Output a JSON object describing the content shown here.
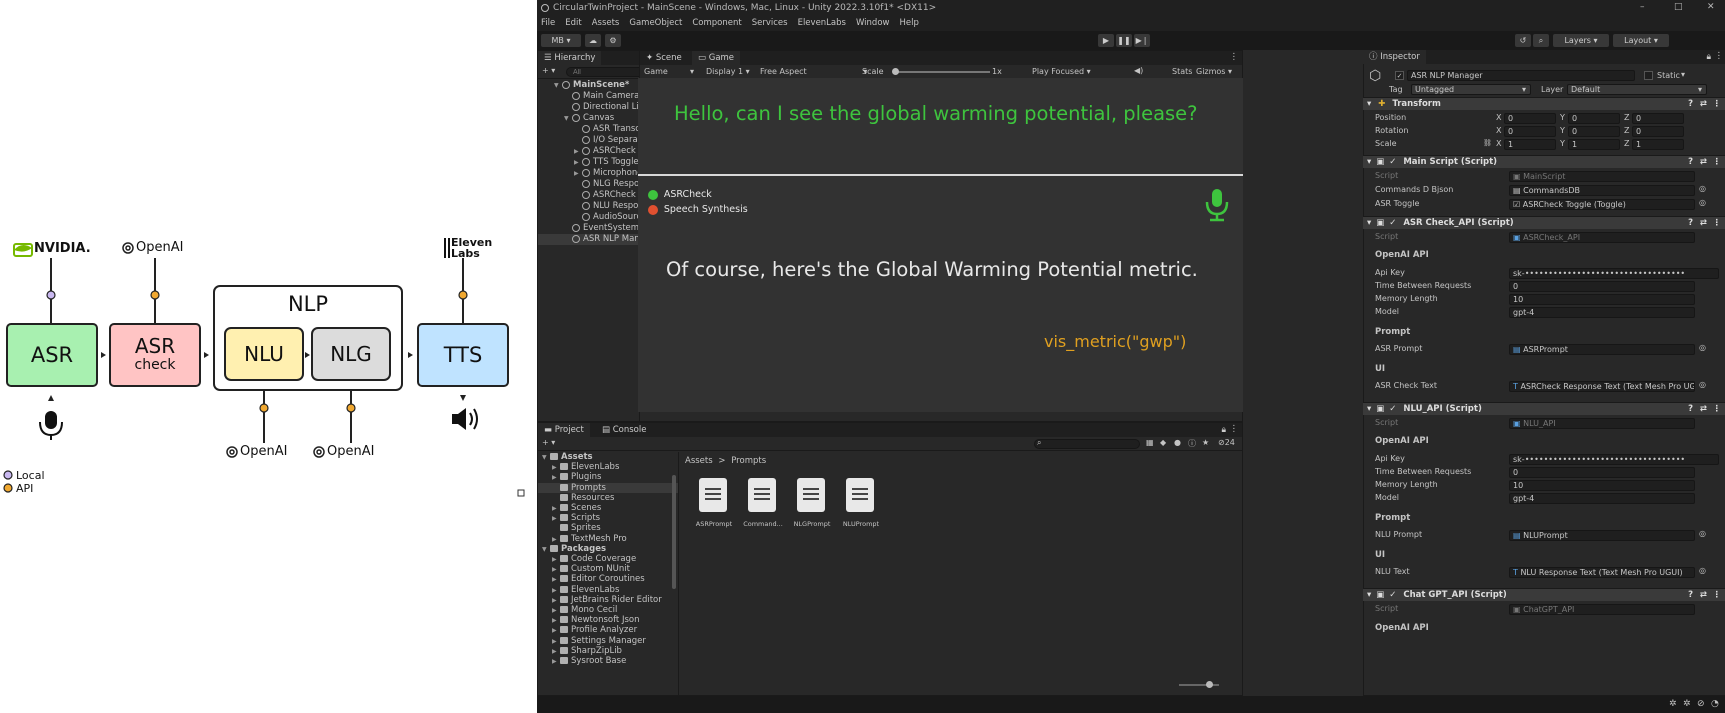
{
  "diagram": {
    "vendors": {
      "nvidia": "NVIDIA.",
      "openai": "OpenAI",
      "elevenlabs_line1": "Eleven",
      "elevenlabs_line2": "Labs"
    },
    "nodes": {
      "asr": "ASR",
      "asr_check_1": "ASR",
      "asr_check_2": "check",
      "nlp": "NLP",
      "nlu": "NLU",
      "nlg": "NLG",
      "tts": "TTS"
    },
    "legend": {
      "local": "Local",
      "api": "API"
    },
    "colors": {
      "asr": "#a8f0b0",
      "asr_check": "#ffc4c4",
      "nlu": "#fff0b0",
      "nlg": "#dcdcdc",
      "tts": "#bfe3ff",
      "local_dot": "#c9b8f0",
      "api_dot": "#f0a830"
    }
  },
  "unity": {
    "title": "CircularTwinProject - MainScene - Windows, Mac, Linux - Unity 2022.3.10f1* <DX11>",
    "menu": [
      "File",
      "Edit",
      "Assets",
      "GameObject",
      "Component",
      "Services",
      "ElevenLabs",
      "Window",
      "Help"
    ],
    "toolbar": {
      "account": "MB",
      "layers": "Layers",
      "layout": "Layout"
    },
    "hierarchy": {
      "tab": "Hierarchy",
      "search_placeholder": "All",
      "items": [
        {
          "label": "MainScene*",
          "depth": 0
        },
        {
          "label": "Main Camera",
          "depth": 1
        },
        {
          "label": "Directional Light",
          "depth": 1
        },
        {
          "label": "Canvas",
          "depth": 1
        },
        {
          "label": "ASR Transcript",
          "depth": 2
        },
        {
          "label": "I/O Separator",
          "depth": 2
        },
        {
          "label": "ASRCheck Toggle",
          "depth": 2
        },
        {
          "label": "TTS Toggle",
          "depth": 2
        },
        {
          "label": "Microphone Toggle",
          "depth": 2
        },
        {
          "label": "NLG Response Text",
          "depth": 2
        },
        {
          "label": "ASRCheck Response Te",
          "depth": 2
        },
        {
          "label": "NLU Response Text",
          "depth": 2
        },
        {
          "label": "AudioSource",
          "depth": 2
        },
        {
          "label": "EventSystem",
          "depth": 1
        },
        {
          "label": "ASR NLP Manager",
          "depth": 1
        }
      ]
    },
    "scene_tabs": {
      "scene": "Scene",
      "game": "Game"
    },
    "game_bar": {
      "mode": "Game",
      "display": "Display 1",
      "aspect": "Free Aspect",
      "scale_label": "Scale",
      "scale_value": "1x",
      "play_focused": "Play Focused",
      "stats": "Stats",
      "gizmos": "Gizmos"
    },
    "game": {
      "user_text": "Hello, can I see the global warming potential, please?",
      "toggle_asrcheck": "ASRCheck",
      "toggle_tts": "Speech Synthesis",
      "response_text": "Of course, here's the Global Warming Potential metric.",
      "command_text": "vis_metric(\"gwp\")",
      "colors": {
        "user_text": "#3ec43e",
        "command_text": "#e0a020",
        "toggle_on": "#3ec43e",
        "toggle_off": "#e05030"
      }
    },
    "project": {
      "tabs": {
        "project": "Project",
        "console": "Console"
      },
      "badge": "24",
      "breadcrumb": {
        "root": "Assets",
        "current": "Prompts"
      },
      "tree": [
        {
          "label": "Assets",
          "depth": 0
        },
        {
          "label": "ElevenLabs",
          "depth": 1
        },
        {
          "label": "Plugins",
          "depth": 1
        },
        {
          "label": "Prompts",
          "depth": 1
        },
        {
          "label": "Resources",
          "depth": 1
        },
        {
          "label": "Scenes",
          "depth": 1
        },
        {
          "label": "Scripts",
          "depth": 1
        },
        {
          "label": "Sprites",
          "depth": 1
        },
        {
          "label": "TextMesh Pro",
          "depth": 1
        },
        {
          "label": "Packages",
          "depth": 0
        },
        {
          "label": "Code Coverage",
          "depth": 1
        },
        {
          "label": "Custom NUnit",
          "depth": 1
        },
        {
          "label": "Editor Coroutines",
          "depth": 1
        },
        {
          "label": "ElevenLabs",
          "depth": 1
        },
        {
          "label": "JetBrains Rider Editor",
          "depth": 1
        },
        {
          "label": "Mono Cecil",
          "depth": 1
        },
        {
          "label": "Newtonsoft Json",
          "depth": 1
        },
        {
          "label": "Profile Analyzer",
          "depth": 1
        },
        {
          "label": "Settings Manager",
          "depth": 1
        },
        {
          "label": "SharpZipLib",
          "depth": 1
        },
        {
          "label": "Sysroot Base",
          "depth": 1
        }
      ],
      "files": [
        "ASRPrompt",
        "Command...",
        "NLGPrompt",
        "NLUPrompt"
      ]
    },
    "inspector": {
      "tab": "Inspector",
      "object_name": "ASR NLP Manager",
      "static": "Static",
      "tag_label": "Tag",
      "tag_value": "Untagged",
      "layer_label": "Layer",
      "layer_value": "Default",
      "transform": {
        "title": "Transform",
        "position": "Position",
        "rotation": "Rotation",
        "scale": "Scale",
        "pos": [
          "0",
          "0",
          "0"
        ],
        "rot": [
          "0",
          "0",
          "0"
        ],
        "scl": [
          "1",
          "1",
          "1"
        ]
      },
      "main_script": {
        "title": "Main Script (Script)",
        "script_label": "Script",
        "script_value": "MainScript",
        "commands_label": "Commands D Bjson",
        "commands_value": "CommandsDB",
        "toggle_label": "ASR Toggle",
        "toggle_value": "ASRCheck Toggle (Toggle)"
      },
      "asr_check_api": {
        "title": "ASR Check_API (Script)",
        "script_label": "Script",
        "script_value": "ASRCheck_API",
        "openai": "OpenAI API",
        "api_key": "Api Key",
        "api_key_value": "sk-••••••••••••••••••••••••••••••••••",
        "time": "Time Between Requests",
        "time_value": "0",
        "memory": "Memory Length",
        "memory_value": "10",
        "model": "Model",
        "model_value": "gpt-4",
        "prompt_section": "Prompt",
        "prompt_label": "ASR Prompt",
        "prompt_value": "ASRPrompt",
        "ui_section": "UI",
        "text_label": "ASR Check Text",
        "text_value": "ASRCheck Response Text (Text Mesh Pro UGUI)"
      },
      "nlu_api": {
        "title": "NLU_API (Script)",
        "script_label": "Script",
        "script_value": "NLU_API",
        "openai": "OpenAI API",
        "api_key": "Api Key",
        "api_key_value": "sk-••••••••••••••••••••••••••••••••••",
        "time": "Time Between Requests",
        "time_value": "0",
        "memory": "Memory Length",
        "memory_value": "10",
        "model": "Model",
        "model_value": "gpt-4",
        "prompt_section": "Prompt",
        "prompt_label": "NLU Prompt",
        "prompt_value": "NLUPrompt",
        "ui_section": "UI",
        "text_label": "NLU Text",
        "text_value": "NLU Response Text (Text Mesh Pro UGUI)"
      },
      "chat_gpt_api": {
        "title": "Chat GPT_API (Script)",
        "script_label": "Script",
        "script_value": "ChatGPT_API",
        "openai": "OpenAI API"
      }
    }
  }
}
